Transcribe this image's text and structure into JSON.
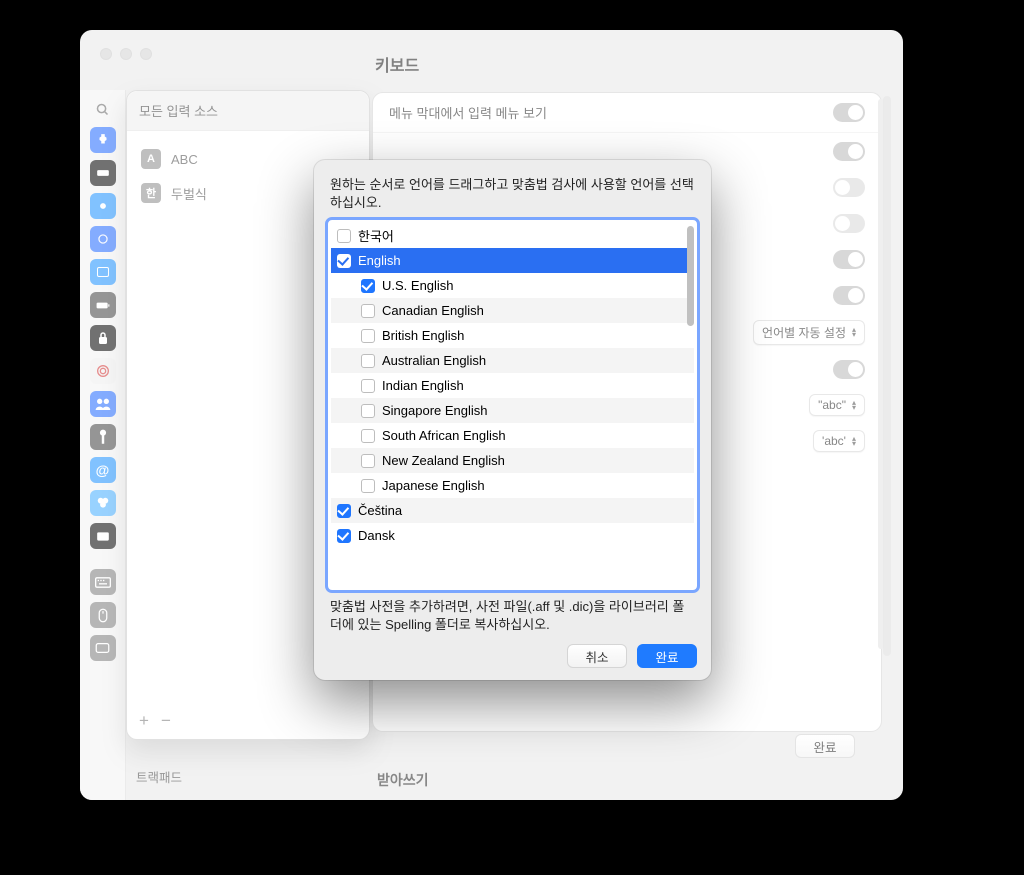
{
  "window": {
    "title": "키보드"
  },
  "secondary_sidebar": {
    "title": "모든 입력 소스",
    "items": [
      {
        "badge": "A",
        "label": "ABC"
      },
      {
        "badge": "한",
        "label": "두벌식"
      }
    ],
    "add_label": "+",
    "remove_label": "−"
  },
  "leftbar_bottom_label": "트랙패드",
  "content": {
    "rows": [
      {
        "label": "메뉴 막대에서 입력 메뉴 보기",
        "toggle": "on"
      }
    ],
    "spell_popup": "언어별 자동 설정",
    "quote_popup_1": "\"abc\"",
    "quote_popup_2": "'abc'",
    "done": "완료",
    "section_below": "받아쓰기"
  },
  "modal": {
    "instruction": "원하는 순서로 언어를 드래그하고 맞춤법 검사에 사용할 언어를 선택하십시오.",
    "hint": "맞춤법 사전을 추가하려면, 사전 파일(.aff 및 .dic)을 라이브러리 폴더에 있는 Spelling 폴더로 복사하십시오.",
    "cancel": "취소",
    "done": "완료",
    "languages": [
      {
        "label": "한국어",
        "checked": false,
        "indent": 0,
        "selected": false
      },
      {
        "label": "English",
        "checked": true,
        "indent": 0,
        "selected": true
      },
      {
        "label": "U.S. English",
        "checked": true,
        "indent": 1,
        "selected": false
      },
      {
        "label": "Canadian English",
        "checked": false,
        "indent": 1,
        "selected": false
      },
      {
        "label": "British English",
        "checked": false,
        "indent": 1,
        "selected": false
      },
      {
        "label": "Australian English",
        "checked": false,
        "indent": 1,
        "selected": false
      },
      {
        "label": "Indian English",
        "checked": false,
        "indent": 1,
        "selected": false
      },
      {
        "label": "Singapore English",
        "checked": false,
        "indent": 1,
        "selected": false
      },
      {
        "label": "South African English",
        "checked": false,
        "indent": 1,
        "selected": false
      },
      {
        "label": "New Zealand English",
        "checked": false,
        "indent": 1,
        "selected": false
      },
      {
        "label": "Japanese English",
        "checked": false,
        "indent": 1,
        "selected": false
      },
      {
        "label": "Čeština",
        "checked": true,
        "indent": 0,
        "selected": false
      },
      {
        "label": "Dansk",
        "checked": true,
        "indent": 0,
        "selected": false
      }
    ]
  }
}
